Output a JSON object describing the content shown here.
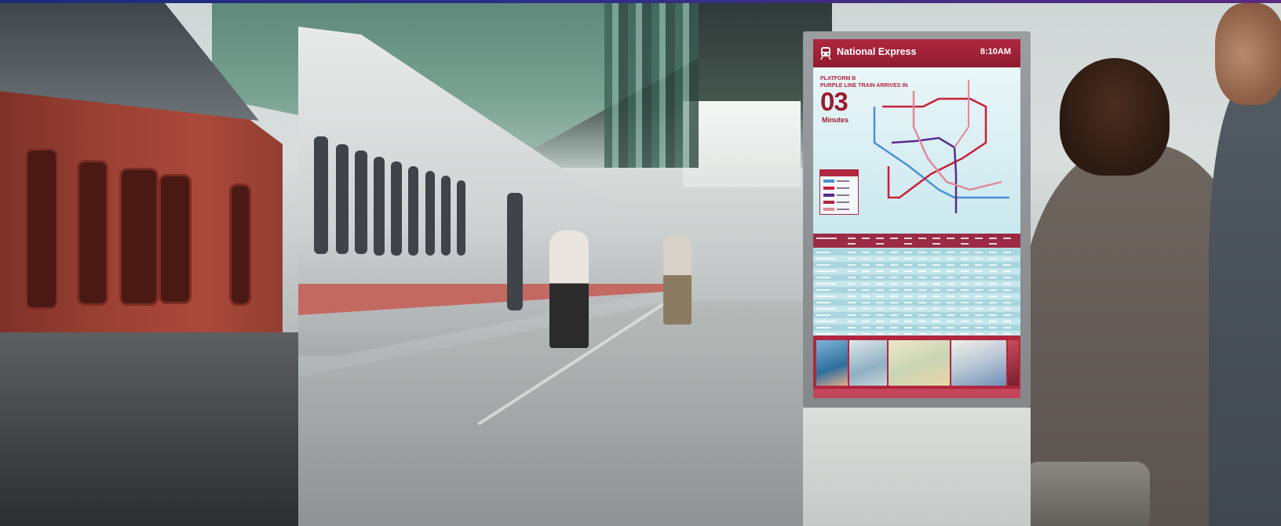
{
  "kiosk": {
    "brand": "National Express",
    "time": "8:10AM",
    "platform_line1": "PLATFORM B",
    "platform_line2": "PURPLE LINE TRAIN ARRIVES IN",
    "countdown": "03",
    "countdown_unit": "Minutes"
  },
  "colors": {
    "brand_red": "#b0273f",
    "dark_red": "#9b1c2f",
    "blue_line": "#4a90d9",
    "red_line": "#c8203a",
    "purple_line": "#5a2a8c",
    "pink_line": "#e08a9a",
    "top_bar": "#1d2a7a"
  },
  "icons": {
    "brand": "train-icon"
  }
}
